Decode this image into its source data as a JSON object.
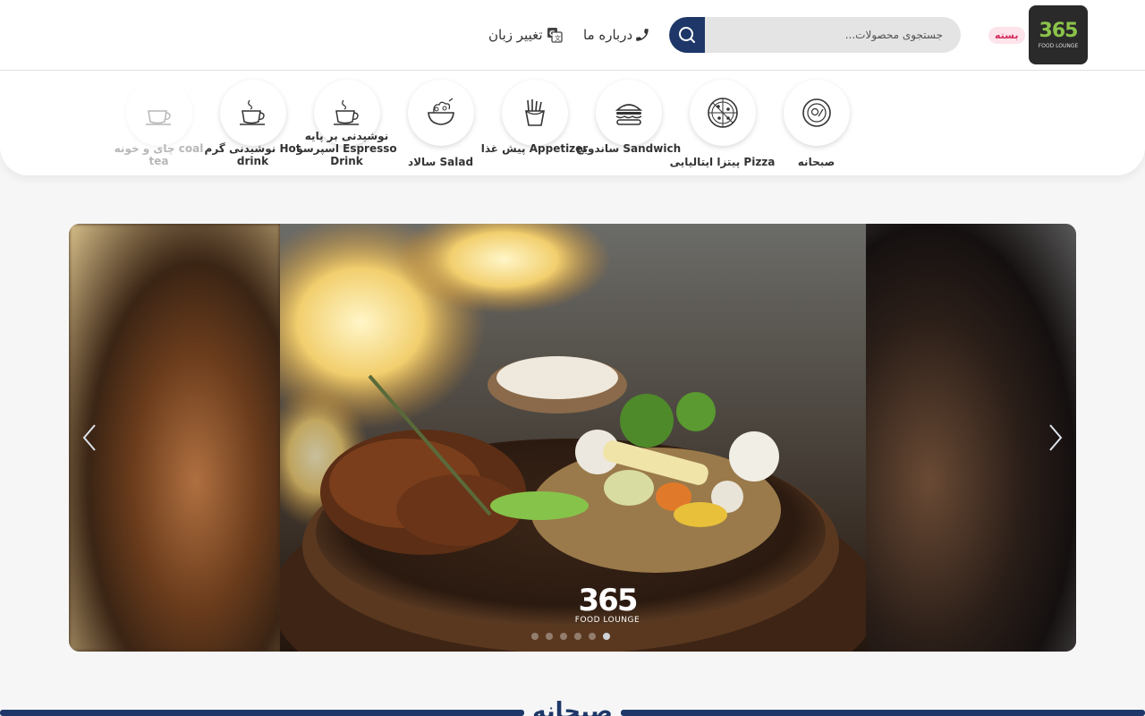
{
  "header": {
    "logo": {
      "mark": "365",
      "sub": "FOOD LOUNGE"
    },
    "status_badge": "بسته",
    "search": {
      "placeholder": "جستجوی محصولات..."
    },
    "about_label": "درباره ما",
    "language_label": "تغییر زبان"
  },
  "categories": [
    {
      "label": "صبحانه",
      "icon": "breakfast-plate-icon"
    },
    {
      "label": "پیتزا ایتالیایی Pizza",
      "icon": "pizza-icon"
    },
    {
      "label": "ساندویچ Sandwich",
      "icon": "burger-icon"
    },
    {
      "label": "پیش غذا Appetizer",
      "icon": "fries-icon"
    },
    {
      "label": "سالاد Salad",
      "icon": "salad-icon"
    },
    {
      "label": "نوشیدنی بر پایه اسپرسو Espresso Drink",
      "icon": "espresso-cup-icon"
    },
    {
      "label": "نوشیدنی گرم Hot drink",
      "icon": "hot-drink-icon"
    },
    {
      "label": "چای و خونه coal tea",
      "icon": "tea-cup-icon"
    }
  ],
  "slider": {
    "slide_count": 6,
    "active_index": 5,
    "watermark": {
      "num": "365",
      "sub": "FOOD LOUNGE"
    }
  },
  "section": {
    "title": "صبحانه"
  },
  "colors": {
    "primary": "#1e3768",
    "badge_bg": "#fde4ea",
    "badge_text": "#d32f5e",
    "accent_green": "#8bc34a"
  }
}
